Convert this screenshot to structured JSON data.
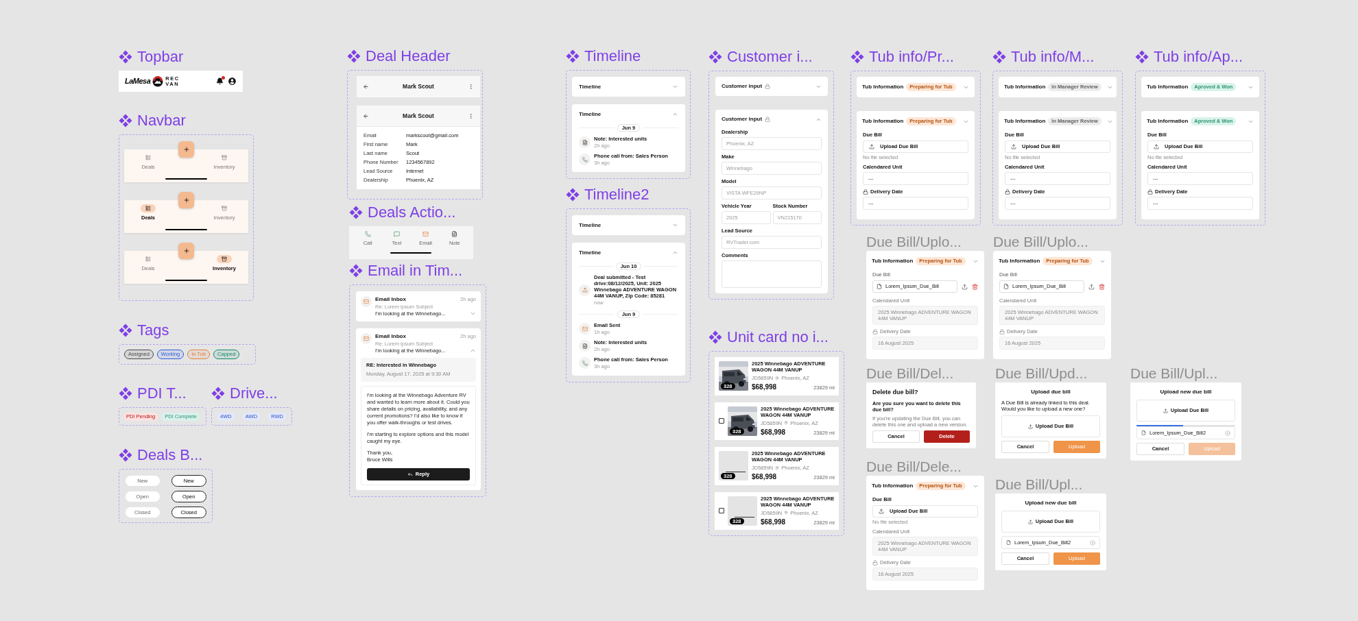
{
  "topbar": {
    "title": "Topbar",
    "logo_word": "LaMesa",
    "logo_rec": "REC",
    "logo_van": "VAN",
    "notifications": true
  },
  "navbar": {
    "title": "Navbar",
    "variants": [
      {
        "items": [
          {
            "label": "Deals",
            "kind": "deals",
            "selected": false
          },
          {
            "label": "Inventory",
            "kind": "inventory",
            "selected": false
          }
        ]
      },
      {
        "items": [
          {
            "label": "Deals",
            "kind": "deals",
            "selected": true
          },
          {
            "label": "Inventory",
            "kind": "inventory",
            "selected": false
          }
        ]
      },
      {
        "items": [
          {
            "label": "Deals",
            "kind": "deals",
            "selected": false
          },
          {
            "label": "Inventory",
            "kind": "inventory",
            "selected": true
          }
        ]
      }
    ]
  },
  "tags": {
    "title": "Tags",
    "items": [
      {
        "label": "Assigned",
        "color": "#4b4b4b"
      },
      {
        "label": "Working",
        "color": "#2f5fe0"
      },
      {
        "label": "In Tub",
        "color": "#e0823d"
      },
      {
        "label": "Capped",
        "color": "#128a6a"
      }
    ]
  },
  "pdi_tags": {
    "title": "PDI T...",
    "items": [
      {
        "label": "PDI Pending",
        "color": "#fde2e2"
      },
      {
        "label": "PDI Complete",
        "color": "#d9f2ec"
      }
    ]
  },
  "drive_tags": {
    "title": "Drive...",
    "items": [
      {
        "label": "4WD"
      },
      {
        "label": "AWD"
      },
      {
        "label": "RWD"
      }
    ]
  },
  "deal_buttons": {
    "title": "Deals B...",
    "buttons": [
      {
        "label": "New",
        "selected": false
      },
      {
        "label": "New",
        "selected": true
      },
      {
        "label": "Open",
        "selected": false
      },
      {
        "label": "Open",
        "selected": true
      },
      {
        "label": "Closed",
        "selected": false
      },
      {
        "label": "Closed",
        "selected": true
      }
    ]
  },
  "deal_header": {
    "title": "Deal Header",
    "headers": [
      {
        "name": "Mark Scout",
        "expanded": false
      },
      {
        "name": "Mark Scout",
        "expanded": true,
        "details": [
          {
            "label": "Email",
            "value": "markscout@gmail.com"
          },
          {
            "label": "First name",
            "value": "Mark"
          },
          {
            "label": "Last name",
            "value": "Scout"
          },
          {
            "label": "Phone Number",
            "value": "1234567892"
          },
          {
            "label": "Lead Source",
            "value": "Internet"
          },
          {
            "label": "Dealership",
            "value": "Phoenix, AZ"
          }
        ]
      }
    ]
  },
  "deals_actions": {
    "title": "Deals Actio...",
    "actions": [
      {
        "label": "Call",
        "kind": "call"
      },
      {
        "label": "Text",
        "kind": "text"
      },
      {
        "label": "Email",
        "kind": "email"
      },
      {
        "label": "Note",
        "kind": "note"
      }
    ]
  },
  "email_timeline": {
    "title": "Email in Tim...",
    "emails": [
      {
        "from": "Email Inbox",
        "time": "2h ago",
        "subject": "Re: Lorem ipsum Subject",
        "preview": "I'm looking at the Winnebago...",
        "expanded": false
      },
      {
        "from": "Email Inbox",
        "time": "2h ago",
        "subject": "Re: Lorem ipsum Subject",
        "preview": "I'm looking at the Winnebago...",
        "expanded": true,
        "message": {
          "subject": "RE: Interested in Winnebago",
          "date": "Monday, August 17, 2025 at 9:30 AM",
          "paragraphs": [
            "I'm looking at the Winnebago Adventure RV and wanted to learn more about it. Could you share details on pricing, availability, and any current promotions? I'd also like to know if you offer walk-throughs or test drives.",
            "I'm starting to explore options and this model caught my eye."
          ],
          "signoff": [
            "Thank you,",
            "Bruce Wills"
          ],
          "reply": "Reply"
        }
      }
    ]
  },
  "timeline": {
    "title": "Timeline",
    "panels": [
      {
        "heading": "Timeline",
        "expanded": false
      },
      {
        "heading": "Timeline",
        "expanded": true,
        "groups": [
          {
            "date": "Jun 9",
            "events": [
              {
                "kind": "note",
                "text": "Note: Interested units",
                "time": "2h ago"
              },
              {
                "kind": "call",
                "text": "Phone call from: Sales Person",
                "time": "3h ago"
              }
            ]
          }
        ]
      }
    ]
  },
  "timeline2": {
    "title": "Timeline2",
    "panels": [
      {
        "heading": "Timeline",
        "expanded": false
      },
      {
        "heading": "Timeline",
        "expanded": true,
        "groups": [
          {
            "date": "Jun 10",
            "events": [
              {
                "kind": "upload",
                "text": "Deal submitted - Test drive:08/12/2025, Unit: 2025 Winnebago ADVENTURE WAGON 44M VANUP, Zip Code: 85281",
                "time": "now"
              }
            ]
          },
          {
            "date": "Jun 9",
            "events": [
              {
                "kind": "email",
                "text": "Email Sent",
                "time": "1h ago"
              },
              {
                "kind": "note",
                "text": "Note: Interested units",
                "time": "2h ago"
              },
              {
                "kind": "call",
                "text": "Phone call from: Sales Person",
                "time": "3h ago"
              }
            ]
          }
        ]
      }
    ]
  },
  "customer_input": {
    "title": "Customer i...",
    "panels": [
      {
        "heading": "Customer input",
        "expanded": false
      },
      {
        "heading": "Customer input",
        "expanded": true,
        "rows": [
          {
            "fields": [
              {
                "label": "Dealership",
                "placeholder": "Phoenix, AZ",
                "kind": "text"
              }
            ]
          },
          {
            "fields": [
              {
                "label": "Make",
                "placeholder": "Winnebago",
                "kind": "text"
              }
            ]
          },
          {
            "fields": [
              {
                "label": "Model",
                "placeholder": "VISTA WFE29NP",
                "kind": "text"
              }
            ]
          },
          {
            "fields": [
              {
                "label": "Vehicle Year",
                "placeholder": "2025",
                "kind": "text"
              },
              {
                "label": "Stock Number",
                "placeholder": "VN215170",
                "kind": "text"
              }
            ]
          },
          {
            "fields": [
              {
                "label": "Lead Source",
                "placeholder": "RVTrader.com",
                "kind": "text"
              }
            ]
          },
          {
            "fields": [
              {
                "label": "Comments",
                "kind": "textarea"
              }
            ]
          }
        ]
      }
    ]
  },
  "unit_cards": {
    "title": "Unit card no i...",
    "cards": [
      {
        "kind": "plain",
        "photo": true,
        "photo_count": "328",
        "title": "2025 Winnebago ADVENTURE WAGON 44M VANUP",
        "stock": "JD5859N",
        "location": "Phoenix, AZ",
        "price": "$68,998",
        "mileage": "23829 mi"
      },
      {
        "kind": "checkbox",
        "checked": false,
        "photo": true,
        "photo_count": "328",
        "title": "2025 Winnebago ADVENTURE WAGON 44M VANUP",
        "stock": "JD5859N",
        "location": "Phoenix, AZ",
        "price": "$68,998",
        "mileage": "23829 mi"
      },
      {
        "kind": "plain",
        "photo": false,
        "photo_count": "328",
        "title": "2025 Winnebago ADVENTURE WAGON 44M VANUP",
        "stock": "JD5859N",
        "location": "Phoenix, AZ",
        "price": "$68,998",
        "mileage": "23829 mi"
      },
      {
        "kind": "checkbox",
        "checked": false,
        "photo": false,
        "photo_count": "328",
        "title": "2025 Winnebago ADVENTURE WAGON 44M VANUP",
        "stock": "JD5859N",
        "location": "Phoenix, AZ",
        "price": "$68,998",
        "mileage": "23829 mi"
      }
    ]
  },
  "tub_info": [
    {
      "title": "Tub info/Pr...",
      "color": "#fde6d6",
      "panels": [
        {
          "heading": "Tub Information",
          "status": "Preparing for Tub",
          "expanded": false
        },
        {
          "heading": "Tub Information",
          "status": "Preparing for Tub",
          "expanded": true,
          "due_bill": {
            "kind": "empty",
            "label": "Due Bill",
            "upload": "Upload Due Bill",
            "note": "No file selected"
          },
          "fields": [
            {
              "label": "Calendared Unit",
              "value": "---",
              "locked": false,
              "disabled": false
            },
            {
              "label": "Delivery Date",
              "value": "---",
              "locked": true,
              "disabled": false
            }
          ]
        }
      ]
    },
    {
      "title": "Tub info/M...",
      "color": "#ececec",
      "panels": [
        {
          "heading": "Tub Information",
          "status": "In Manager Review",
          "expanded": false
        },
        {
          "heading": "Tub Information",
          "status": "In Manager Review",
          "expanded": true,
          "due_bill": {
            "kind": "empty",
            "label": "Due Bill",
            "upload": "Upload Due Bill",
            "note": "No file selected"
          },
          "fields": [
            {
              "label": "Calendared Unit",
              "value": "---",
              "locked": false,
              "disabled": false
            },
            {
              "label": "Delivery Date",
              "value": "---",
              "locked": true,
              "disabled": false
            }
          ]
        }
      ]
    },
    {
      "title": "Tub info/Ap...",
      "color": "#d8f3ea",
      "panels": [
        {
          "heading": "Tub Information",
          "status": "Aproved & Won",
          "expanded": false
        },
        {
          "heading": "Tub Information",
          "status": "Aproved & Won",
          "expanded": true,
          "due_bill": {
            "kind": "empty",
            "label": "Due Bill",
            "upload": "Upload Due Bill",
            "note": "No file selected"
          },
          "fields": [
            {
              "label": "Calendared Unit",
              "value": "---",
              "locked": false,
              "disabled": false
            },
            {
              "label": "Delivery Date",
              "value": "---",
              "locked": true,
              "disabled": false
            }
          ]
        }
      ]
    }
  ],
  "due_bill_variants": [
    {
      "label": "Due Bill/Uplo...",
      "kind": "tub",
      "color": "#fde6d6",
      "panel": {
        "heading": "Tub Information",
        "status": "Preparing for Tub",
        "expanded": true,
        "due_bill": {
          "kind": "file",
          "label": "Due Bill",
          "file": "Lorem_Ipsum_Due_Bill"
        },
        "fields": [
          {
            "label": "Calendared Unit",
            "value": "2025 Winnebago ADVENTURE WAGON 44M VANUP",
            "locked": false,
            "disabled": true
          },
          {
            "label": "Delivery Date",
            "value": "16 August 2025",
            "locked": true,
            "disabled": true
          }
        ]
      }
    },
    {
      "label": "Due Bill/Uplo...",
      "kind": "tub",
      "color": "#fde6d6",
      "panel": {
        "heading": "Tub Information",
        "status": "Preparing for Tub",
        "expanded": true,
        "due_bill": {
          "kind": "file",
          "label": "Due Bill",
          "file": "Lorem_Ipsum_Due_Bill"
        },
        "fields": [
          {
            "label": "Calendared Unit",
            "value": "2025 Winnebago ADVENTURE WAGON 44M VANUP",
            "locked": false,
            "disabled": true
          },
          {
            "label": "Delivery Date",
            "value": "16 August 2025",
            "locked": true,
            "disabled": true
          }
        ]
      }
    },
    {
      "label": "Due Bill/Del...",
      "kind": "delete_dialog",
      "heading": "Delete due bill?",
      "question": "Are you sure you want to delete this due bill?",
      "note": "If you're updating the Due Bill, you can delete this one and upload a new version.",
      "cancel": "Cancel",
      "confirm": "Delete"
    },
    {
      "label": "Due Bill/Upd...",
      "kind": "upload_dialog",
      "heading": "Upload due bill",
      "message": "A Due Bill is already linked to this deal. Would you like to upload a new one?",
      "upload": "Upload Due Bill",
      "cancel": "Cancel",
      "confirm": "Upload"
    },
    {
      "label": "Due Bill/Upl...",
      "kind": "upload_new",
      "heading": "Upload new due bill",
      "upload": "Upload Due Bill",
      "file": "Lorem_Ipsum_Due_Bill2",
      "level": 0.47,
      "cancel": "Cancel",
      "confirm": "Upload",
      "disabled": true
    },
    {
      "label": "Due Bill/Dele...",
      "kind": "tub",
      "color": "#fde6d6",
      "panel": {
        "heading": "Tub Information",
        "status": "Preparing for Tub",
        "expanded": true,
        "due_bill": {
          "kind": "empty",
          "label": "Due Bill",
          "upload": "Upload Due Bill",
          "note": "No file selected"
        },
        "fields": [
          {
            "label": "Calendared Unit",
            "value": "2025 Winnebago ADVENTURE WAGON 44M VANUP",
            "locked": false,
            "disabled": true
          },
          {
            "label": "Delivery Date",
            "value": "16 August 2025",
            "locked": true,
            "disabled": true
          }
        ]
      }
    },
    {
      "label": "Due Bill/Upl...",
      "kind": "upload_new",
      "heading": "Upload new due bill",
      "upload": "Upload Due Bill",
      "file": "Lorem_Ipsum_Due_Bill2",
      "cancel": "Cancel",
      "confirm": "Upload",
      "disabled": false
    }
  ]
}
